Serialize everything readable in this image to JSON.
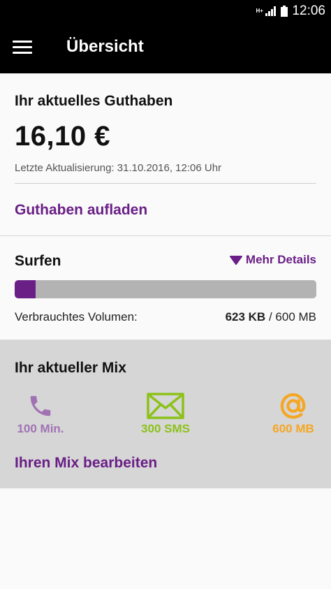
{
  "status_bar": {
    "time": "12:06",
    "network_badge": "H+"
  },
  "app_bar": {
    "title": "Übersicht"
  },
  "balance": {
    "heading": "Ihr aktuelles Guthaben",
    "amount": "16,10 €",
    "last_update": "Letzte Aktualisierung: 31.10.2016, 12:06 Uhr",
    "topup_link": "Guthaben aufladen"
  },
  "data_usage": {
    "heading": "Surfen",
    "details_link": "Mehr Details",
    "used_fraction": 0.0066,
    "volume_label": "Verbrauchtes Volumen:",
    "used": "623 KB",
    "separator": "/",
    "total": "600 MB"
  },
  "mix": {
    "heading": "Ihr aktueller Mix",
    "items": [
      {
        "label": "100 Min.",
        "icon": "phone-icon",
        "color": "#a072b4"
      },
      {
        "label": "300 SMS",
        "icon": "envelope-icon",
        "color": "#8cc21a"
      },
      {
        "label": "600 MB",
        "icon": "at-sign-icon",
        "color": "#f5a623"
      }
    ],
    "edit_link": "Ihren Mix bearbeiten"
  },
  "colors": {
    "accent": "#6a1f86",
    "app_bar": "#000000",
    "track": "#b3b3b3",
    "mix_background": "#d6d6d6"
  }
}
